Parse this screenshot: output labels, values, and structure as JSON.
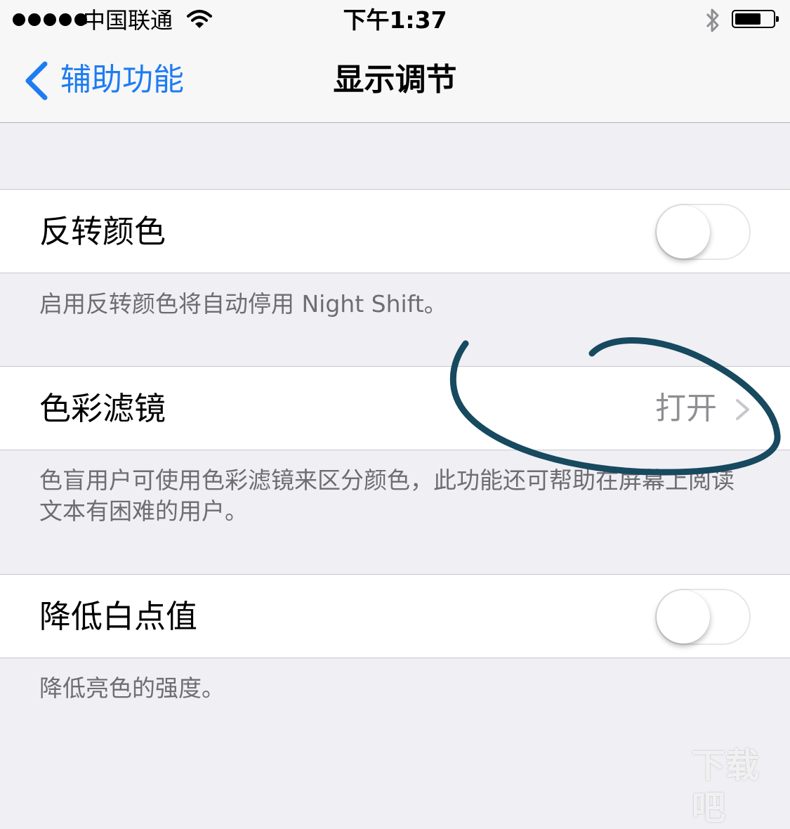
{
  "status_bar": {
    "carrier": "中国联通",
    "time": "下午1:37",
    "icons": [
      "signal-dots-icon",
      "wifi-icon",
      "bluetooth-icon",
      "battery-icon"
    ]
  },
  "nav": {
    "back_label": "辅助功能",
    "title": "显示调节"
  },
  "cells": {
    "invert_colors": {
      "label": "反转颜色",
      "toggle_on": false
    },
    "color_filters": {
      "label": "色彩滤镜",
      "value": "打开"
    },
    "reduce_white_point": {
      "label": "降低白点值",
      "toggle_on": false
    }
  },
  "footers": {
    "invert_colors": "启用反转颜色将自动停用 Night Shift。",
    "color_filters": "色盲用户可使用色彩滤镜来区分颜色，此功能还可帮助在屏幕上阅读文本有困难的用户。",
    "reduce_white_point": "降低亮色的强度。"
  },
  "watermark": "下载吧",
  "colors": {
    "accent": "#1d7cf2",
    "background": "#efeff4",
    "footer_text": "#6d6d72",
    "annotation_ink": "#17495f"
  }
}
